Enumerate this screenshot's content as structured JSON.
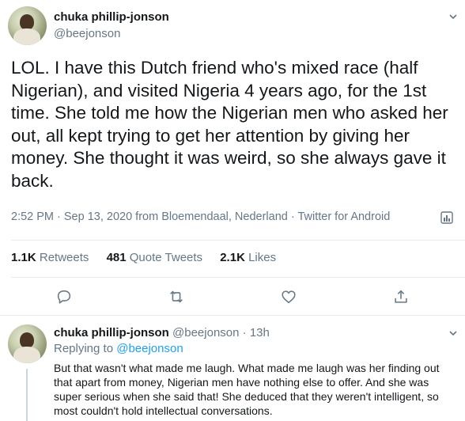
{
  "main_tweet": {
    "author_name": "chuka phillip-jonson",
    "author_handle": "@beejonson",
    "text": "LOL. I have this Dutch friend who's mixed race (half Nigerian), and visited Nigeria 4 years ago, for the 1st time. She told me how the Nigerian men who asked her out, all kept trying to get her attention by giving her money. She thought it was weird, so she always gave it back.",
    "timestamp": "2:52 PM · Sep 13, 2020 from Bloemendaal, Nederland · Twitter for Android",
    "stats": {
      "retweets_count": "1.1K",
      "retweets_label": "Retweets",
      "quotes_count": "481",
      "quotes_label": "Quote Tweets",
      "likes_count": "2.1K",
      "likes_label": "Likes"
    },
    "actions": {
      "reply_icon": "comment-icon",
      "retweet_icon": "retweet-icon",
      "like_icon": "heart-icon",
      "share_icon": "share-icon"
    }
  },
  "reply_tweet": {
    "author_name": "chuka phillip-jonson",
    "author_handle": "@beejonson",
    "time": "· 13h",
    "replying_label": "Replying to",
    "replying_to": "@beejonson",
    "text": "But that wasn't what made me laugh. What made me laugh was her finding out that apart from money, Nigerian men have nothing else to offer. And she was super serious when she said that! She deduced that they weren't intelligent, so most couldn't hold intellectual conversations."
  },
  "colors": {
    "text": "#14171a",
    "secondary": "#657786",
    "link": "#1da1f2",
    "divider": "#e6ecf0"
  }
}
